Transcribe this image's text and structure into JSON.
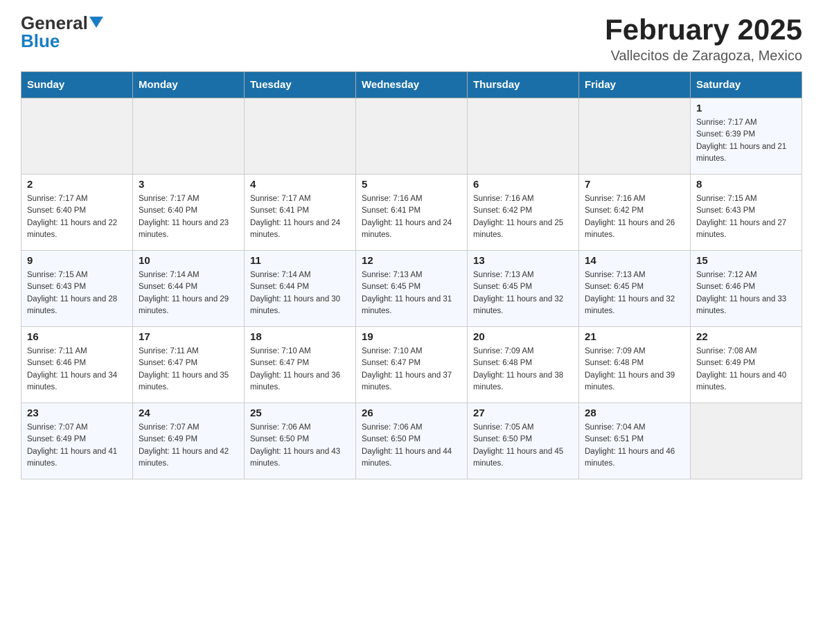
{
  "header": {
    "logo_general": "General",
    "logo_blue": "Blue",
    "title": "February 2025",
    "location": "Vallecitos de Zaragoza, Mexico"
  },
  "weekdays": [
    "Sunday",
    "Monday",
    "Tuesday",
    "Wednesday",
    "Thursday",
    "Friday",
    "Saturday"
  ],
  "weeks": [
    [
      {
        "day": "",
        "sunrise": "",
        "sunset": "",
        "daylight": ""
      },
      {
        "day": "",
        "sunrise": "",
        "sunset": "",
        "daylight": ""
      },
      {
        "day": "",
        "sunrise": "",
        "sunset": "",
        "daylight": ""
      },
      {
        "day": "",
        "sunrise": "",
        "sunset": "",
        "daylight": ""
      },
      {
        "day": "",
        "sunrise": "",
        "sunset": "",
        "daylight": ""
      },
      {
        "day": "",
        "sunrise": "",
        "sunset": "",
        "daylight": ""
      },
      {
        "day": "1",
        "sunrise": "Sunrise: 7:17 AM",
        "sunset": "Sunset: 6:39 PM",
        "daylight": "Daylight: 11 hours and 21 minutes."
      }
    ],
    [
      {
        "day": "2",
        "sunrise": "Sunrise: 7:17 AM",
        "sunset": "Sunset: 6:40 PM",
        "daylight": "Daylight: 11 hours and 22 minutes."
      },
      {
        "day": "3",
        "sunrise": "Sunrise: 7:17 AM",
        "sunset": "Sunset: 6:40 PM",
        "daylight": "Daylight: 11 hours and 23 minutes."
      },
      {
        "day": "4",
        "sunrise": "Sunrise: 7:17 AM",
        "sunset": "Sunset: 6:41 PM",
        "daylight": "Daylight: 11 hours and 24 minutes."
      },
      {
        "day": "5",
        "sunrise": "Sunrise: 7:16 AM",
        "sunset": "Sunset: 6:41 PM",
        "daylight": "Daylight: 11 hours and 24 minutes."
      },
      {
        "day": "6",
        "sunrise": "Sunrise: 7:16 AM",
        "sunset": "Sunset: 6:42 PM",
        "daylight": "Daylight: 11 hours and 25 minutes."
      },
      {
        "day": "7",
        "sunrise": "Sunrise: 7:16 AM",
        "sunset": "Sunset: 6:42 PM",
        "daylight": "Daylight: 11 hours and 26 minutes."
      },
      {
        "day": "8",
        "sunrise": "Sunrise: 7:15 AM",
        "sunset": "Sunset: 6:43 PM",
        "daylight": "Daylight: 11 hours and 27 minutes."
      }
    ],
    [
      {
        "day": "9",
        "sunrise": "Sunrise: 7:15 AM",
        "sunset": "Sunset: 6:43 PM",
        "daylight": "Daylight: 11 hours and 28 minutes."
      },
      {
        "day": "10",
        "sunrise": "Sunrise: 7:14 AM",
        "sunset": "Sunset: 6:44 PM",
        "daylight": "Daylight: 11 hours and 29 minutes."
      },
      {
        "day": "11",
        "sunrise": "Sunrise: 7:14 AM",
        "sunset": "Sunset: 6:44 PM",
        "daylight": "Daylight: 11 hours and 30 minutes."
      },
      {
        "day": "12",
        "sunrise": "Sunrise: 7:13 AM",
        "sunset": "Sunset: 6:45 PM",
        "daylight": "Daylight: 11 hours and 31 minutes."
      },
      {
        "day": "13",
        "sunrise": "Sunrise: 7:13 AM",
        "sunset": "Sunset: 6:45 PM",
        "daylight": "Daylight: 11 hours and 32 minutes."
      },
      {
        "day": "14",
        "sunrise": "Sunrise: 7:13 AM",
        "sunset": "Sunset: 6:45 PM",
        "daylight": "Daylight: 11 hours and 32 minutes."
      },
      {
        "day": "15",
        "sunrise": "Sunrise: 7:12 AM",
        "sunset": "Sunset: 6:46 PM",
        "daylight": "Daylight: 11 hours and 33 minutes."
      }
    ],
    [
      {
        "day": "16",
        "sunrise": "Sunrise: 7:11 AM",
        "sunset": "Sunset: 6:46 PM",
        "daylight": "Daylight: 11 hours and 34 minutes."
      },
      {
        "day": "17",
        "sunrise": "Sunrise: 7:11 AM",
        "sunset": "Sunset: 6:47 PM",
        "daylight": "Daylight: 11 hours and 35 minutes."
      },
      {
        "day": "18",
        "sunrise": "Sunrise: 7:10 AM",
        "sunset": "Sunset: 6:47 PM",
        "daylight": "Daylight: 11 hours and 36 minutes."
      },
      {
        "day": "19",
        "sunrise": "Sunrise: 7:10 AM",
        "sunset": "Sunset: 6:47 PM",
        "daylight": "Daylight: 11 hours and 37 minutes."
      },
      {
        "day": "20",
        "sunrise": "Sunrise: 7:09 AM",
        "sunset": "Sunset: 6:48 PM",
        "daylight": "Daylight: 11 hours and 38 minutes."
      },
      {
        "day": "21",
        "sunrise": "Sunrise: 7:09 AM",
        "sunset": "Sunset: 6:48 PM",
        "daylight": "Daylight: 11 hours and 39 minutes."
      },
      {
        "day": "22",
        "sunrise": "Sunrise: 7:08 AM",
        "sunset": "Sunset: 6:49 PM",
        "daylight": "Daylight: 11 hours and 40 minutes."
      }
    ],
    [
      {
        "day": "23",
        "sunrise": "Sunrise: 7:07 AM",
        "sunset": "Sunset: 6:49 PM",
        "daylight": "Daylight: 11 hours and 41 minutes."
      },
      {
        "day": "24",
        "sunrise": "Sunrise: 7:07 AM",
        "sunset": "Sunset: 6:49 PM",
        "daylight": "Daylight: 11 hours and 42 minutes."
      },
      {
        "day": "25",
        "sunrise": "Sunrise: 7:06 AM",
        "sunset": "Sunset: 6:50 PM",
        "daylight": "Daylight: 11 hours and 43 minutes."
      },
      {
        "day": "26",
        "sunrise": "Sunrise: 7:06 AM",
        "sunset": "Sunset: 6:50 PM",
        "daylight": "Daylight: 11 hours and 44 minutes."
      },
      {
        "day": "27",
        "sunrise": "Sunrise: 7:05 AM",
        "sunset": "Sunset: 6:50 PM",
        "daylight": "Daylight: 11 hours and 45 minutes."
      },
      {
        "day": "28",
        "sunrise": "Sunrise: 7:04 AM",
        "sunset": "Sunset: 6:51 PM",
        "daylight": "Daylight: 11 hours and 46 minutes."
      },
      {
        "day": "",
        "sunrise": "",
        "sunset": "",
        "daylight": ""
      }
    ]
  ]
}
